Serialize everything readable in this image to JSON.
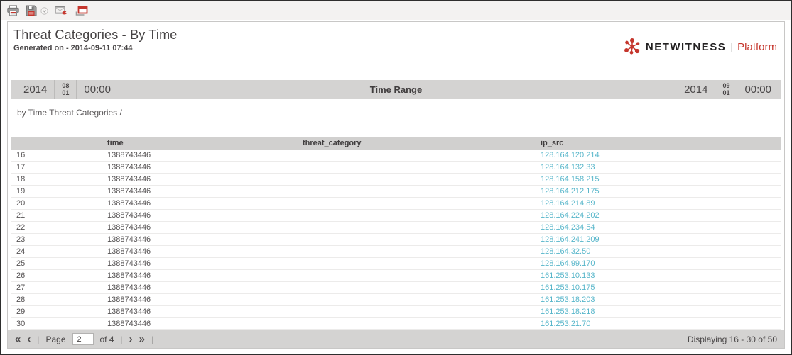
{
  "toolbar": {
    "icons": [
      "print-icon",
      "save-icon",
      "save-dropdown-icon",
      "email-report-icon",
      "open-window-icon"
    ]
  },
  "header": {
    "title": "Threat Categories - By Time",
    "generated_on": "Generated on - 2014-09-11 07:44",
    "logo": {
      "brand": "NETWITNESS",
      "divider": "|",
      "product": "Platform"
    }
  },
  "time_range": {
    "label": "Time Range",
    "start": {
      "year": "2014",
      "month": "08",
      "day": "01",
      "time": "00:00"
    },
    "end": {
      "year": "2014",
      "month": "09",
      "day": "01",
      "time": "00:00"
    }
  },
  "breadcrumb": {
    "text": "by Time Threat Categories /"
  },
  "table": {
    "columns": [
      "",
      "time",
      "threat_category",
      "ip_src"
    ],
    "rows": [
      {
        "index": "16",
        "time": "1388743446",
        "threat_category": "",
        "ip_src": "128.164.120.214"
      },
      {
        "index": "17",
        "time": "1388743446",
        "threat_category": "",
        "ip_src": "128.164.132.33"
      },
      {
        "index": "18",
        "time": "1388743446",
        "threat_category": "",
        "ip_src": "128.164.158.215"
      },
      {
        "index": "19",
        "time": "1388743446",
        "threat_category": "",
        "ip_src": "128.164.212.175"
      },
      {
        "index": "20",
        "time": "1388743446",
        "threat_category": "",
        "ip_src": "128.164.214.89"
      },
      {
        "index": "21",
        "time": "1388743446",
        "threat_category": "",
        "ip_src": "128.164.224.202"
      },
      {
        "index": "22",
        "time": "1388743446",
        "threat_category": "",
        "ip_src": "128.164.234.54"
      },
      {
        "index": "23",
        "time": "1388743446",
        "threat_category": "",
        "ip_src": "128.164.241.209"
      },
      {
        "index": "24",
        "time": "1388743446",
        "threat_category": "",
        "ip_src": "128.164.32.50"
      },
      {
        "index": "25",
        "time": "1388743446",
        "threat_category": "",
        "ip_src": "128.164.99.170"
      },
      {
        "index": "26",
        "time": "1388743446",
        "threat_category": "",
        "ip_src": "161.253.10.133"
      },
      {
        "index": "27",
        "time": "1388743446",
        "threat_category": "",
        "ip_src": "161.253.10.175"
      },
      {
        "index": "28",
        "time": "1388743446",
        "threat_category": "",
        "ip_src": "161.253.18.203"
      },
      {
        "index": "29",
        "time": "1388743446",
        "threat_category": "",
        "ip_src": "161.253.18.218"
      },
      {
        "index": "30",
        "time": "1388743446",
        "threat_category": "",
        "ip_src": "161.253.21.70"
      }
    ]
  },
  "pagination": {
    "first": "«",
    "prev": "‹",
    "separator": "|",
    "page_label": "Page",
    "page_value": "2",
    "of_text": "of 4",
    "next": "›",
    "last": "»",
    "status": "Displaying 16 - 30 of 50"
  },
  "colors": {
    "accent_red": "#c5362d",
    "link_blue": "#57b6ca",
    "bar_gray": "#d4d3d2",
    "header_gray": "#d1d0cf"
  }
}
